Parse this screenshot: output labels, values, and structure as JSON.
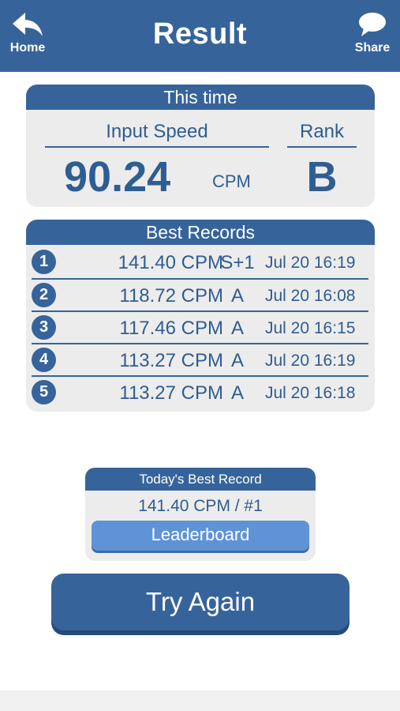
{
  "header": {
    "title": "Result",
    "home_label": "Home",
    "share_label": "Share",
    "home_icon": "back-arrow-icon",
    "share_icon": "speech-bubble-icon"
  },
  "this_time": {
    "heading": "This time",
    "speed_label": "Input Speed",
    "rank_label": "Rank",
    "speed_value": "90.24",
    "speed_unit": "CPM",
    "rank_value": "B"
  },
  "best_records": {
    "heading": "Best Records",
    "rows": [
      {
        "num": "1",
        "cpm": "141.40 CPM",
        "rank": "S+1",
        "date": "Jul 20 16:19"
      },
      {
        "num": "2",
        "cpm": "118.72 CPM",
        "rank": "A",
        "date": "Jul 20 16:08"
      },
      {
        "num": "3",
        "cpm": "117.46 CPM",
        "rank": "A",
        "date": "Jul 20 16:15"
      },
      {
        "num": "4",
        "cpm": "113.27 CPM",
        "rank": "A",
        "date": "Jul 20 16:19"
      },
      {
        "num": "5",
        "cpm": "113.27 CPM",
        "rank": "A",
        "date": "Jul 20 16:18"
      }
    ]
  },
  "today": {
    "heading": "Today's Best Record",
    "value": "141.40 CPM / #1",
    "leaderboard_label": "Leaderboard"
  },
  "try_again_label": "Try Again",
  "colors": {
    "primary": "#36649a",
    "text": "#2e5d92",
    "panel_bg": "#ececec",
    "leaderboard": "#5f93d6"
  }
}
